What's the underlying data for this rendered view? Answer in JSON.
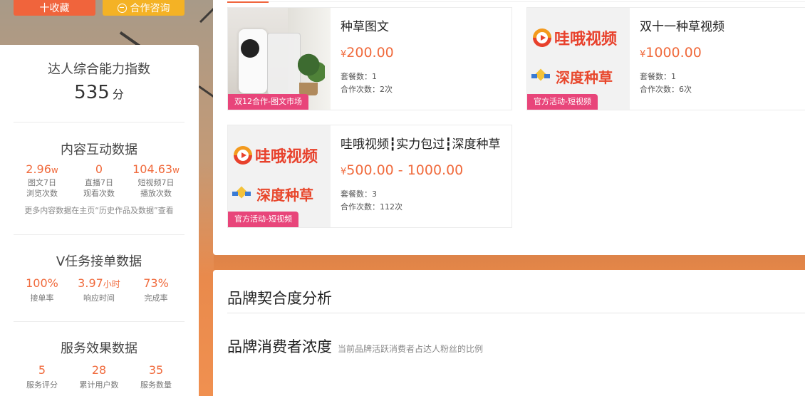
{
  "top_buttons": {
    "collect": "十收藏",
    "consult": "合作咨询"
  },
  "ability": {
    "title": "达人综合能力指数",
    "score": "535",
    "unit": "分"
  },
  "content_interaction": {
    "title": "内容互动数据",
    "stats": [
      {
        "value": "2.96",
        "unit": "w",
        "label1": "图文7日",
        "label2": "浏览次数"
      },
      {
        "value": "0",
        "unit": "",
        "label1": "直播7日",
        "label2": "观看次数"
      },
      {
        "value": "104.63",
        "unit": "w",
        "label1": "短视频7日",
        "label2": "播放次数"
      }
    ],
    "note": "更多内容数据在主页“历史作品及数据”查看"
  },
  "task_data": {
    "title": "V任务接单数据",
    "stats": [
      {
        "value": "100%",
        "unit": "",
        "label": "接单率"
      },
      {
        "value": "3.97",
        "unit": "小时",
        "label": "响应时间"
      },
      {
        "value": "73%",
        "unit": "",
        "label": "完成率"
      }
    ]
  },
  "service_data": {
    "title": "服务效果数据",
    "stats": [
      {
        "value": "5",
        "label": "服务评分"
      },
      {
        "value": "28",
        "label": "累计用户数"
      },
      {
        "value": "35",
        "label": "服务数量"
      }
    ]
  },
  "packages": [
    {
      "name": "种草图文",
      "yen": "¥",
      "price": "200.00",
      "tag": "双12合作-图文市场",
      "count_label": "套餐数：",
      "count": "1",
      "coop_label": "合作次数：",
      "coop": "2次"
    },
    {
      "name": "双十一种草视频",
      "yen": "¥",
      "price": "1000.00",
      "tag": "官方活动-短视频",
      "count_label": "套餐数：",
      "count": "1",
      "coop_label": "合作次数：",
      "coop": "6次"
    },
    {
      "name": "哇哦视频┇实力包过┇深度种草",
      "yen": "¥",
      "price": "500.00 - 1000.00",
      "tag": "官方活动-短视频",
      "count_label": "套餐数：",
      "count": "3",
      "coop_label": "合作次数：",
      "coop": "112次"
    }
  ],
  "logos": {
    "wahe": "哇哦视频",
    "shendu": "深度种草"
  },
  "brand": {
    "title": "品牌契合度分析",
    "subtitle": "品牌消费者浓度",
    "subtitle_note": "当前品牌活跃消费者占达人粉丝的比例"
  },
  "colors": {
    "accent": "#f06a3c",
    "collect_btn": "#f0643c",
    "consult_btn": "#f4b225",
    "tag": "#e8457a"
  }
}
